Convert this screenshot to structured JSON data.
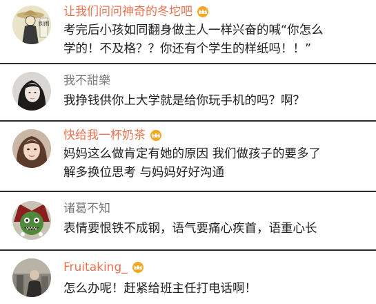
{
  "comments": [
    {
      "user": "让我们问问神奇的冬坨吧",
      "vip": true,
      "avatar_icon": "straw-hat-figure-avatar",
      "avatar_text": "别闹",
      "lines": [
        "考完后小孩如同翻身做主人一样兴奋的喊“你怎么",
        "学的！不及格？？你还有个学生的样纸吗！！”"
      ]
    },
    {
      "user": "我不甜樂",
      "vip": false,
      "avatar_icon": "girl-portrait-avatar",
      "lines": [
        "我挣钱供你上大学就是给你玩手机的吗？啊？"
      ]
    },
    {
      "user": "快给我一杯奶茶",
      "vip": true,
      "avatar_icon": "girl-portrait-avatar",
      "lines": [
        "妈妈这么做肯定有她的原因 我们做孩子的要多了",
        "解多换位思考 与妈妈好好沟通"
      ]
    },
    {
      "user": "诸葛不知",
      "vip": false,
      "avatar_icon": "green-monster-avatar",
      "lines": [
        "表情要恨铁不成钢，语气要痛心疾首，语重心长"
      ]
    },
    {
      "user": "Fruitaking_",
      "vip": true,
      "avatar_icon": "person-photo-avatar",
      "lines": [
        "怎么办呢！赶紧给班主任打电话啊！"
      ]
    }
  ],
  "colors": {
    "vip_name": "#eb7350",
    "plain_name": "#7a7a7a",
    "text": "#222222",
    "divider": "#2b2b2b",
    "badge": "#f5a623"
  }
}
